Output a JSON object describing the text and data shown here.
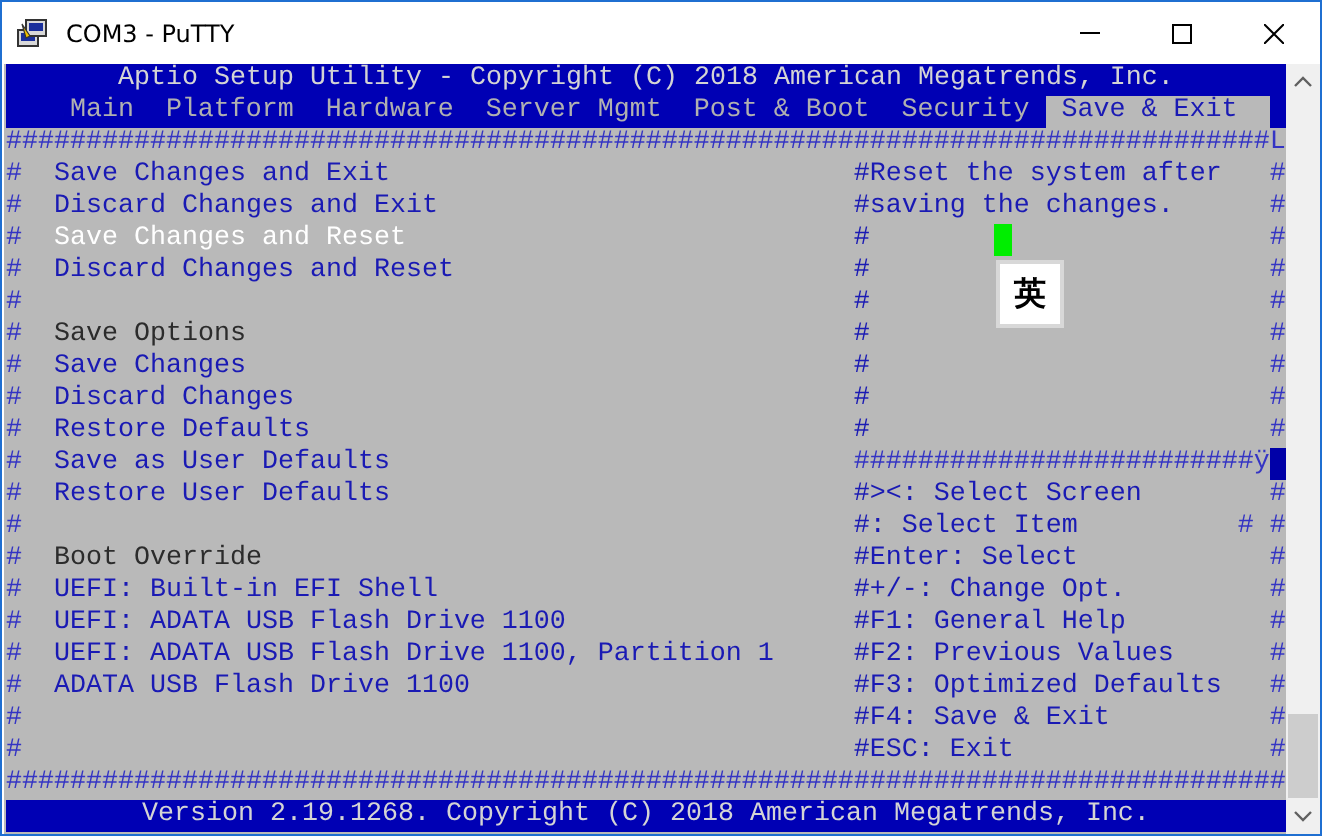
{
  "window": {
    "title": "COM3 - PuTTY"
  },
  "header": "Aptio Setup Utility - Copyright (C) 2018 American Megatrends, Inc.",
  "tabs": [
    {
      "label": "Main",
      "selected": false
    },
    {
      "label": "Platform",
      "selected": false
    },
    {
      "label": "Hardware",
      "selected": false
    },
    {
      "label": "Server Mgmt",
      "selected": false
    },
    {
      "label": "Post & Boot",
      "selected": false
    },
    {
      "label": "Security",
      "selected": false
    },
    {
      "label": "Save & Exit",
      "selected": true
    }
  ],
  "top_border": "###############################################################################L",
  "rows": [
    {
      "kind": "text",
      "left": "#",
      "item": {
        "label": "Save Changes and Exit",
        "kind": "option",
        "selected": false
      },
      "help": "#Reset the system after",
      "right": "#"
    },
    {
      "kind": "text",
      "left": "#",
      "item": {
        "label": "Discard Changes and Exit",
        "kind": "option",
        "selected": false
      },
      "help": "#saving the changes.",
      "right": "#"
    },
    {
      "kind": "text",
      "left": "#",
      "item": {
        "label": "Save Changes and Reset",
        "kind": "option",
        "selected": true
      },
      "help": "#",
      "right": "#"
    },
    {
      "kind": "text",
      "left": "#",
      "item": {
        "label": "Discard Changes and Reset",
        "kind": "option",
        "selected": false
      },
      "help": "#",
      "right": "#"
    },
    {
      "kind": "text",
      "left": "#",
      "help": "#",
      "right": "#"
    },
    {
      "kind": "text",
      "left": "#",
      "item": {
        "label": "Save Options",
        "kind": "heading"
      },
      "help": "#",
      "right": "#"
    },
    {
      "kind": "text",
      "left": "#",
      "item": {
        "label": "Save Changes",
        "kind": "option",
        "selected": false
      },
      "help": "#",
      "right": "#"
    },
    {
      "kind": "text",
      "left": "#",
      "item": {
        "label": "Discard Changes",
        "kind": "option",
        "selected": false
      },
      "help": "#",
      "right": "#"
    },
    {
      "kind": "text",
      "left": "#",
      "item": {
        "label": "Restore Defaults",
        "kind": "option",
        "selected": false
      },
      "help": "#",
      "right": "#"
    },
    {
      "kind": "divider",
      "left": "#",
      "item": {
        "label": "Save as User Defaults",
        "kind": "option",
        "selected": false
      },
      "help": "#########################ÿ"
    },
    {
      "kind": "text",
      "left": "#",
      "item": {
        "label": "Restore User Defaults",
        "kind": "option",
        "selected": false
      },
      "help": "#><: Select Screen",
      "right": "#"
    },
    {
      "kind": "text",
      "left": "#",
      "help": "#: Select Item",
      "right": "# #"
    },
    {
      "kind": "text",
      "left": "#",
      "item": {
        "label": "Boot Override",
        "kind": "heading"
      },
      "help": "#Enter: Select",
      "right": "#"
    },
    {
      "kind": "text",
      "left": "#",
      "item": {
        "label": "UEFI: Built-in EFI Shell",
        "kind": "option",
        "selected": false
      },
      "help": "#+/-: Change Opt.",
      "right": "#"
    },
    {
      "kind": "text",
      "left": "#",
      "item": {
        "label": "UEFI: ADATA USB Flash Drive 1100",
        "kind": "option",
        "selected": false
      },
      "help": "#F1: General Help",
      "right": "#"
    },
    {
      "kind": "text",
      "left": "#",
      "item": {
        "label": "UEFI: ADATA USB Flash Drive 1100, Partition 1",
        "kind": "option",
        "selected": false
      },
      "help": "#F2: Previous Values",
      "right": "#"
    },
    {
      "kind": "text",
      "left": "#",
      "item": {
        "label": "ADATA USB Flash Drive 1100",
        "kind": "option",
        "selected": false
      },
      "help": "#F3: Optimized Defaults",
      "right": "#"
    },
    {
      "kind": "text",
      "left": "#",
      "help": "#F4: Save & Exit",
      "right": "#"
    },
    {
      "kind": "text",
      "left": "#",
      "help": "#ESC: Exit",
      "right": "#"
    }
  ],
  "bottom_border": "################################################################################",
  "footer": "Version 2.19.1268. Copyright (C) 2018 American Megatrends, Inc.",
  "ime_indicator": "英"
}
